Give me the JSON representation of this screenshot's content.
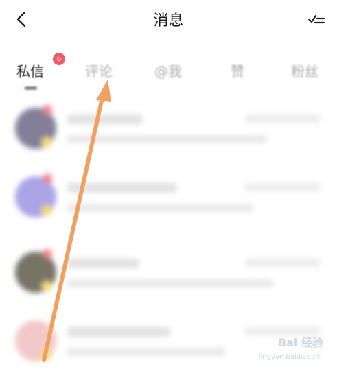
{
  "header": {
    "title": "消息",
    "back_icon": "chevron-left-icon",
    "read_all_icon": "check-list-icon"
  },
  "tabs": [
    {
      "label": "私信",
      "active": true,
      "badge": "6"
    },
    {
      "label": "评论",
      "active": false
    },
    {
      "label": "@我",
      "active": false
    },
    {
      "label": "赞",
      "active": false
    },
    {
      "label": "粉丝",
      "active": false
    }
  ],
  "colors": {
    "badge": "#f25a66",
    "arrow": "#f0a060"
  },
  "messages": [
    {
      "avatar_color": "#5b5576"
    },
    {
      "avatar_color": "#8f86e0"
    },
    {
      "avatar_color": "#4a4634"
    },
    {
      "avatar_color": "#f0b6b6"
    }
  ],
  "watermark": {
    "brand": "Bai 经验",
    "url": "jingyan.baidu.com"
  }
}
